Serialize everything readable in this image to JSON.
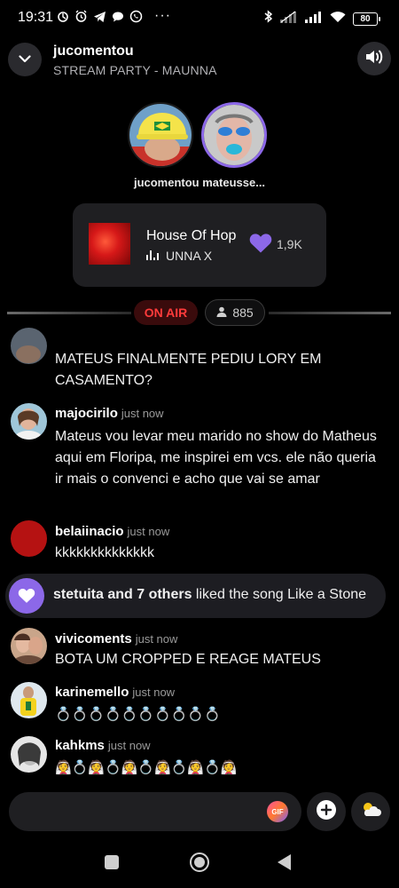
{
  "status_bar": {
    "time": "19:31",
    "left_icons": [
      "sync-icon",
      "alarm-icon",
      "telegram-icon",
      "chat-bubble-icon",
      "whatsapp-icon"
    ],
    "overflow": "···",
    "battery": "80"
  },
  "header": {
    "title": "jucomentou",
    "subtitle": "STREAM PARTY - MAUNNA"
  },
  "hosts": {
    "names": "jucomentou mateusse..."
  },
  "song": {
    "title": "House Of Hope",
    "artist": "UNNA X",
    "likes": "1,9K"
  },
  "live": {
    "status": "ON AIR",
    "viewers": "885"
  },
  "chat": {
    "partial_message": "MATEUS FINALMENTE PEDIU LORY EM CASAMENTO?",
    "messages": [
      {
        "user": "majocirilo",
        "time": "just now",
        "text": "Mateus vou levar meu marido no show do Matheus aqui em Floripa, me inspirei em vcs. ele não queria ir mais o convenci e acho que vai se amar"
      },
      {
        "user": "belaiinacio",
        "time": "just now",
        "text": "kkkkkkkkkkkkkk"
      },
      {
        "user": "vivicoments",
        "time": "just now",
        "text": "BOTA UM CROPPED E REAGE MATEUS"
      },
      {
        "user": "karinemello",
        "time": "just now",
        "text": "💍💍💍💍💍💍💍💍💍💍"
      },
      {
        "user": "kahkms",
        "time": "just now",
        "text": "👰💍👰💍👰💍👰💍👰💍👰"
      }
    ],
    "notice": {
      "actor": "stetuita and 7 others",
      "action": " liked the song Like a Stone"
    }
  },
  "composer": {
    "gif_label": "GIF"
  },
  "colors": {
    "accent_purple": "#8c68e8",
    "on_air_red": "#ff3b3b",
    "background": "#000000"
  }
}
